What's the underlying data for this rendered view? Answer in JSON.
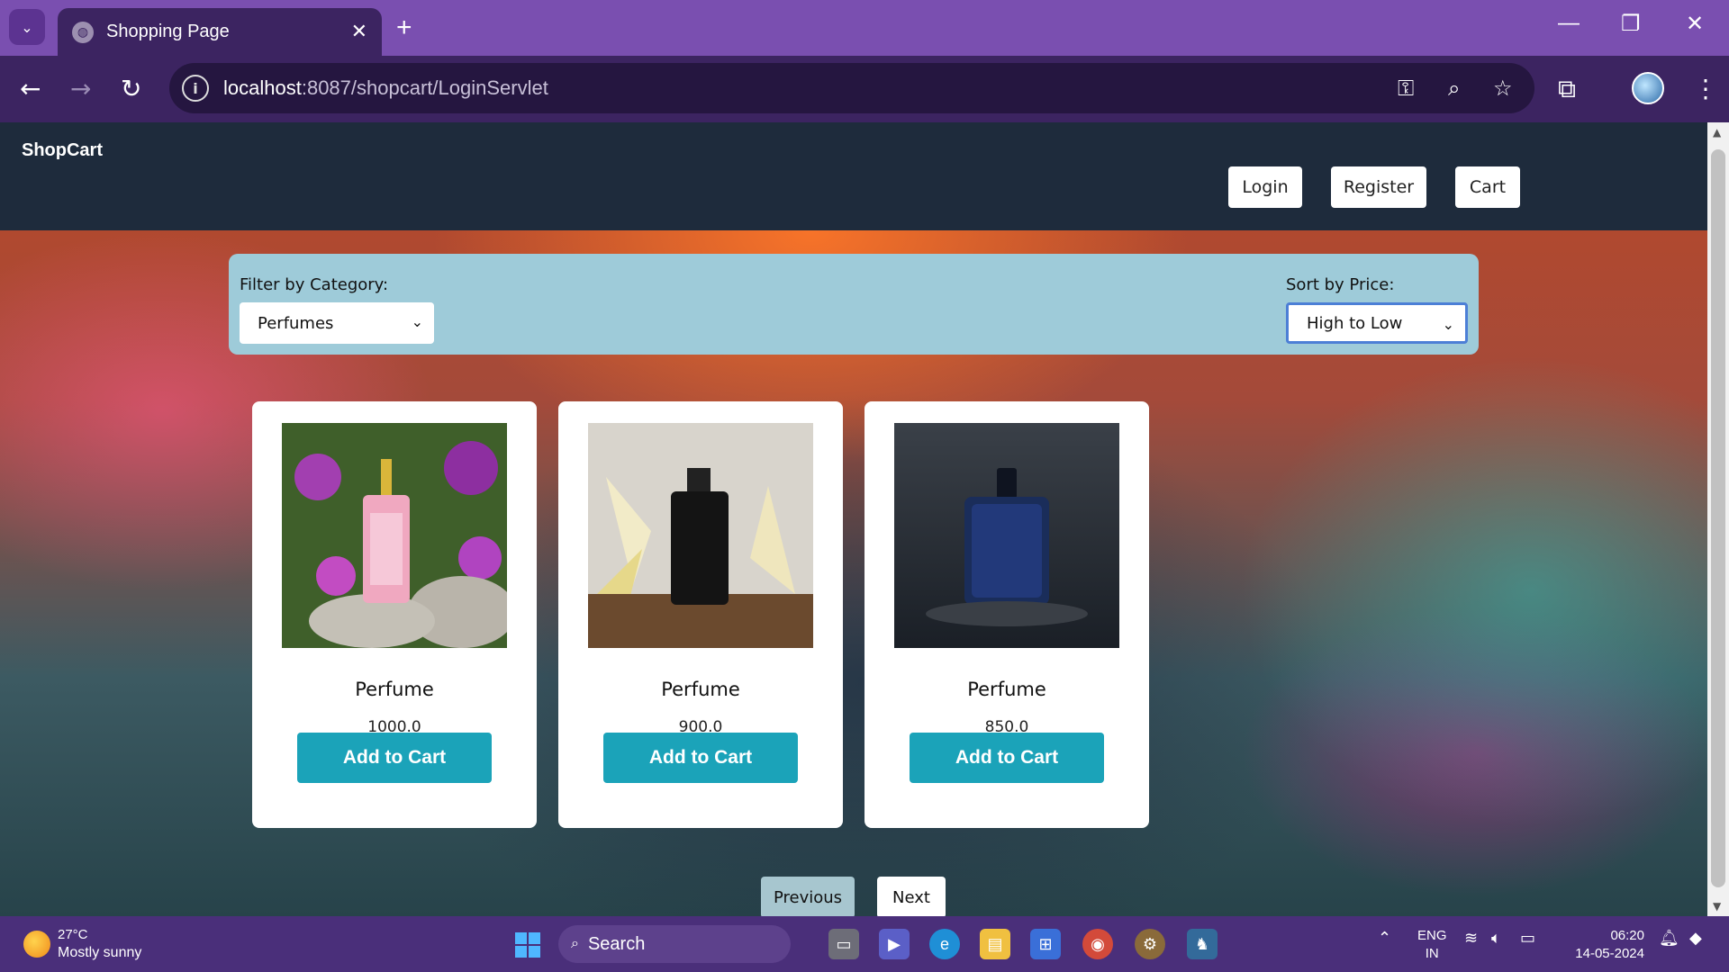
{
  "browser": {
    "tab_title": "Shopping Page",
    "url_host": "localhost",
    "url_path": ":8087/shopcart/LoginServlet",
    "icons": [
      "tab-search-icon",
      "favicon-globe-icon",
      "close-icon",
      "new-tab-icon",
      "minimize-icon",
      "restore-icon",
      "window-close-icon",
      "back-icon",
      "forward-icon",
      "reload-icon",
      "site-info-icon",
      "password-key-icon",
      "zoom-icon",
      "bookmark-star-icon",
      "extensions-icon",
      "profile-avatar",
      "menu-kebab-icon"
    ]
  },
  "navbar": {
    "brand": "ShopCart",
    "login": "Login",
    "register": "Register",
    "cart": "Cart"
  },
  "filters": {
    "category_label": "Filter by Category:",
    "category_value": "Perfumes",
    "sort_label": "Sort by Price:",
    "sort_value": "High to Low"
  },
  "products": [
    {
      "name": "Perfume",
      "price": "1000.0",
      "button": "Add to Cart"
    },
    {
      "name": "Perfume",
      "price": "900.0",
      "button": "Add to Cart"
    },
    {
      "name": "Perfume",
      "price": "850.0",
      "button": "Add to Cart"
    }
  ],
  "pagination": {
    "previous": "Previous",
    "next": "Next"
  },
  "taskbar": {
    "temperature": "27°C",
    "weather": "Mostly sunny",
    "search": "Search",
    "lang_top": "ENG",
    "lang_bottom": "IN",
    "time": "06:20",
    "date": "14-05-2024"
  },
  "colors": {
    "tabstrip": "#7a4fb0",
    "toolbar": "#3c2461",
    "navbar": "#1e2b3c",
    "filterbar": "#9ecbd9",
    "add_button": "#1ba3b9",
    "taskbar": "#4a2f7a"
  }
}
